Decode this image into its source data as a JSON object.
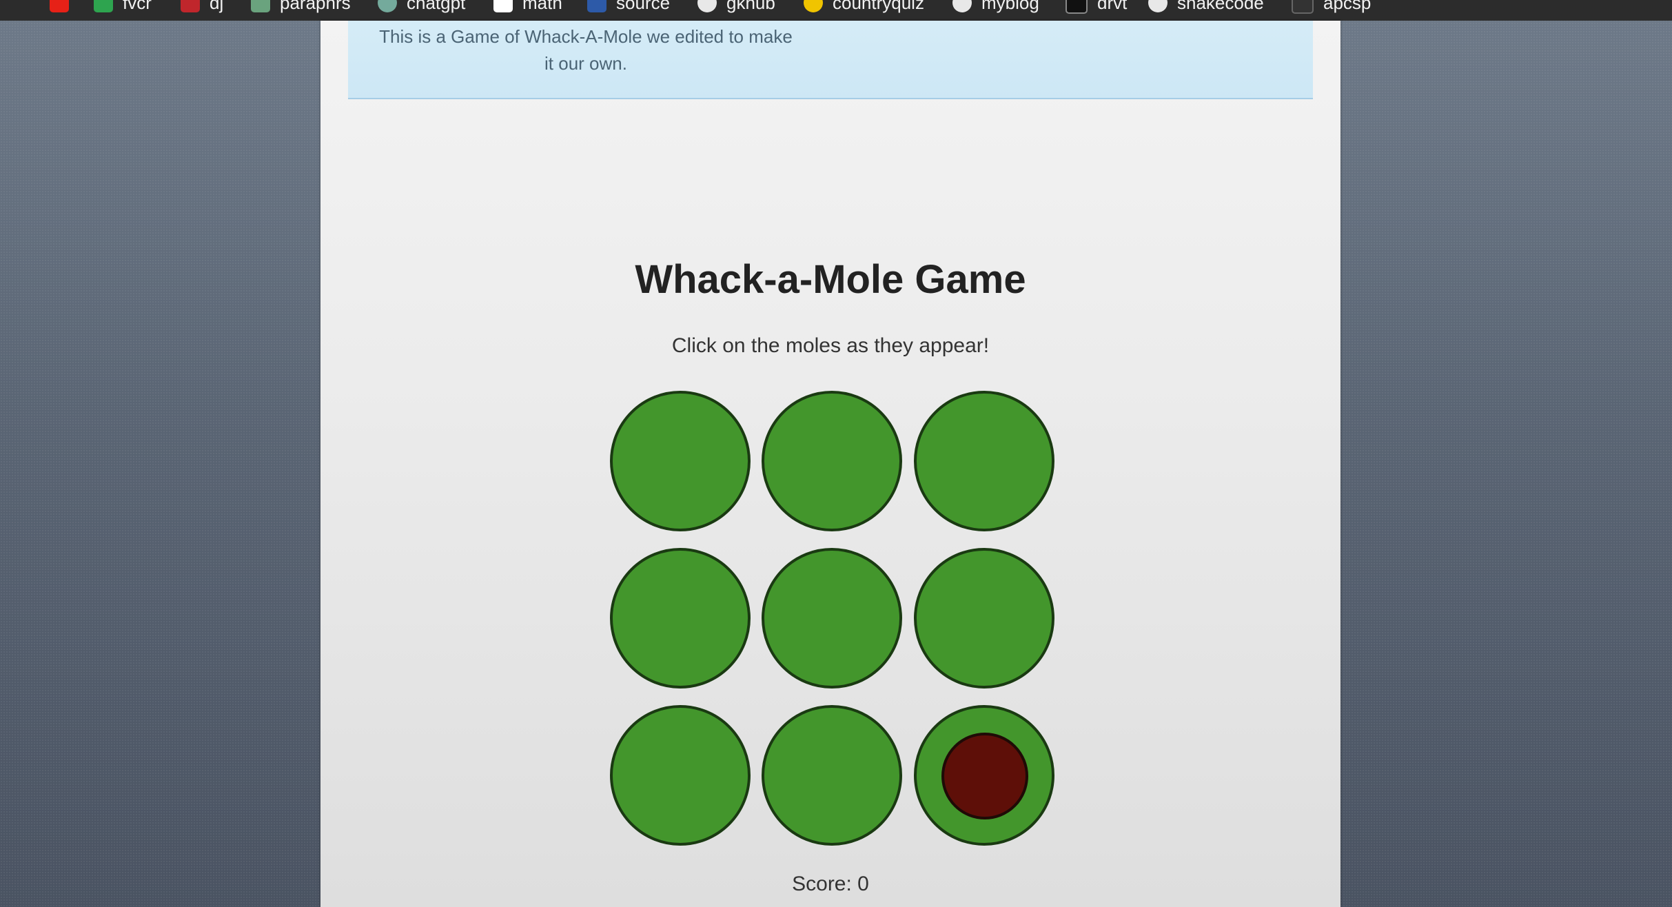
{
  "bookmarks": [
    {
      "label": "",
      "icon": "youtube-icon",
      "color": "#e62117"
    },
    {
      "label": "fvcr",
      "icon": "sheets-icon",
      "color": "#2ea44f"
    },
    {
      "label": "dj",
      "icon": "bookmark-red-icon",
      "color": "#c0262c"
    },
    {
      "label": "paraphrs",
      "icon": "paraphrase-icon",
      "color": "#6aa37e"
    },
    {
      "label": "chatgpt",
      "icon": "chatgpt-icon",
      "color": "#74aa9c"
    },
    {
      "label": "math",
      "icon": "math-icon",
      "color": "#ffffff"
    },
    {
      "label": "source",
      "icon": "source-icon",
      "color": "#2d5aa8"
    },
    {
      "label": "gkhub",
      "icon": "globe-icon",
      "color": "#e8e8e8"
    },
    {
      "label": "countryquiz",
      "icon": "countryquiz-icon",
      "color": "#f0c400"
    },
    {
      "label": "myblog",
      "icon": "blog-icon",
      "color": "#e8e8e8"
    },
    {
      "label": "drvt",
      "icon": "drvt-icon",
      "color": "#111111"
    },
    {
      "label": "snakecode",
      "icon": "github-icon",
      "color": "#e8e8e8"
    },
    {
      "label": "apcsp",
      "icon": "apcsp-icon",
      "color": "#333333"
    }
  ],
  "banner": {
    "text": "This is a Game of Whack-A-Mole we edited to make it our own."
  },
  "game": {
    "title": "Whack-a-Mole Game",
    "instructions": "Click on the moles as they appear!",
    "score_text": "Score: 0",
    "holes": [
      {
        "mole_visible": false
      },
      {
        "mole_visible": false
      },
      {
        "mole_visible": false
      },
      {
        "mole_visible": false
      },
      {
        "mole_visible": false
      },
      {
        "mole_visible": false
      },
      {
        "mole_visible": false
      },
      {
        "mole_visible": false
      },
      {
        "mole_visible": true
      }
    ]
  },
  "colors": {
    "hole": "#43962c",
    "hole_border": "#1a3a12",
    "mole": "#5e0f08",
    "banner": "#d5ecf7"
  }
}
